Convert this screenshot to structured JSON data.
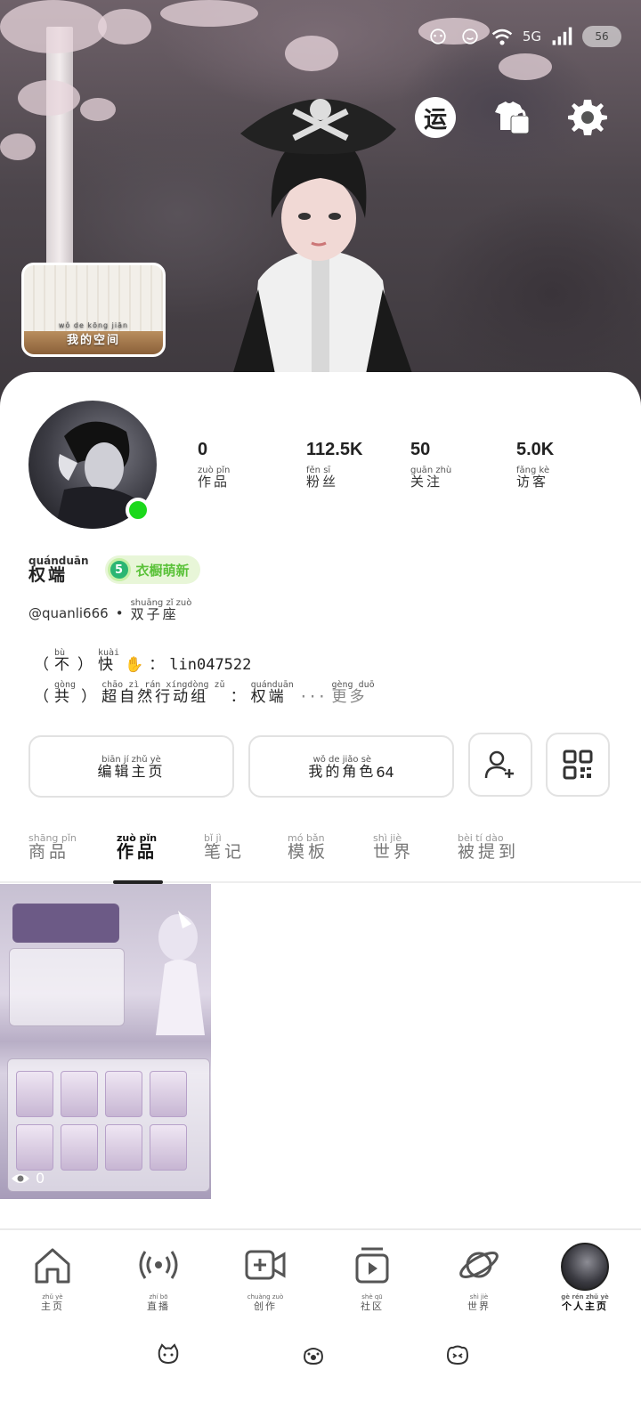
{
  "status_bar": {
    "network": "5G",
    "battery": "56"
  },
  "header": {
    "run_badge": "运",
    "my_space": {
      "pinyin": "wǒ de kōng jiān",
      "label": "我的空间"
    }
  },
  "stats": [
    {
      "value": "0",
      "pinyin": "zuò pǐn",
      "label": "作品"
    },
    {
      "value": "112.5K",
      "pinyin": "fěn sī",
      "label": "粉丝"
    },
    {
      "value": "50",
      "pinyin": "guān zhù",
      "label": "关注"
    },
    {
      "value": "5.0K",
      "pinyin": "fǎng kè",
      "label": "访客"
    }
  ],
  "profile": {
    "name_pinyin": "quánduān",
    "name": "权端",
    "level": "5",
    "badge": "衣橱萌新",
    "handle": "@quanli666",
    "separator": "•",
    "constellation_pinyin": "shuāng zǐ zuò",
    "constellation": "双子座"
  },
  "bio": {
    "line1": {
      "open": "（",
      "bu_py": "bù",
      "bu": "不",
      "close": "）",
      "kuai_py": "kuài",
      "kuai": "快",
      "emoji": "✋",
      "colon": "：",
      "id": "lin047522"
    },
    "line2": {
      "open": "（",
      "gong_py": "gòng",
      "gong": "共",
      "close": "）",
      "group_py": "chāo zì rán xíngdòng zǔ",
      "group": "超自然行动组",
      "colon": "：",
      "name_py": "quánduān",
      "name": "权端",
      "ellipsis": "···",
      "more_py": "gèng duō",
      "more": "更多"
    }
  },
  "buttons": {
    "edit": {
      "pinyin": "biān jí zhǔ yè",
      "label": "编辑主页"
    },
    "roles": {
      "pinyin": "wǒ de jiǎo sè",
      "label": "我的角色",
      "count": "64"
    }
  },
  "tabs": [
    {
      "pinyin": "shāng pǐn",
      "label": "商品"
    },
    {
      "pinyin": "zuò pǐn",
      "label": "作品"
    },
    {
      "pinyin": "bǐ jì",
      "label": "笔记"
    },
    {
      "pinyin": "mó bǎn",
      "label": "模板"
    },
    {
      "pinyin": "shì jiè",
      "label": "世界"
    },
    {
      "pinyin": "bèi tí dào",
      "label": "被提到"
    }
  ],
  "works": [
    {
      "views": "0"
    }
  ],
  "nav": [
    {
      "pinyin": "zhǔ yè",
      "label": "主页",
      "icon": "home-icon"
    },
    {
      "pinyin": "zhí bō",
      "label": "直播",
      "icon": "broadcast-icon"
    },
    {
      "pinyin": "chuàng zuò",
      "label": "创作",
      "icon": "create-video-icon"
    },
    {
      "pinyin": "shè qū",
      "label": "社区",
      "icon": "community-icon"
    },
    {
      "pinyin": "shì jiè",
      "label": "世界",
      "icon": "planet-icon"
    },
    {
      "pinyin": "gè rén zhǔ yè",
      "label": "个人主页",
      "icon": "avatar"
    }
  ],
  "colors": {
    "online": "#1bd81b",
    "badge_text": "#5bc23a",
    "badge_bg": "#e8f6d8"
  }
}
